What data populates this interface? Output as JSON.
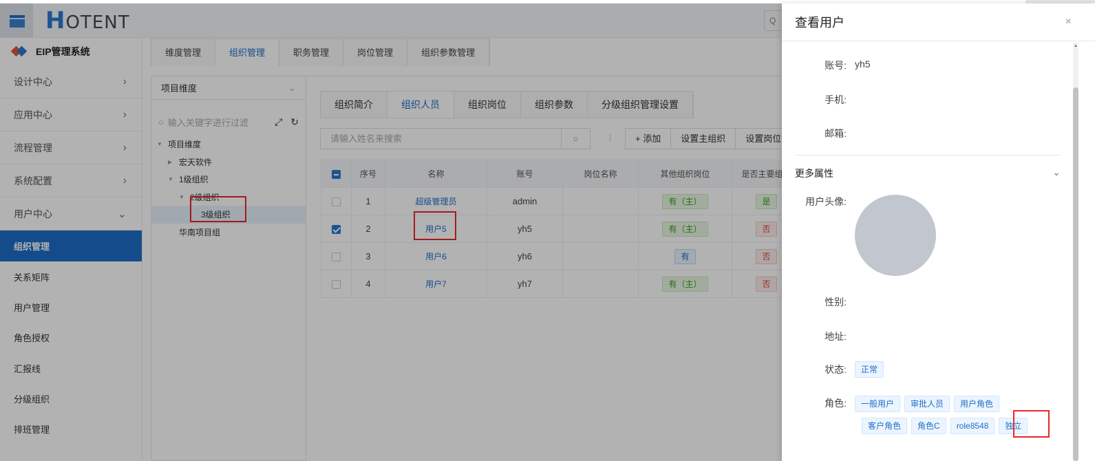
{
  "header": {
    "logo_text_big": "H",
    "logo_text_rest": "OTENT"
  },
  "sidebar": {
    "app_name": "EIP管理系统",
    "groups": [
      {
        "label": "设计中心",
        "chevron": ">"
      },
      {
        "label": "应用中心",
        "chevron": ">"
      },
      {
        "label": "流程管理",
        "chevron": ">"
      },
      {
        "label": "系统配置",
        "chevron": ">"
      },
      {
        "label": "用户中心",
        "chevron": "v"
      }
    ],
    "items": [
      {
        "label": "组织管理"
      },
      {
        "label": "关系矩阵"
      },
      {
        "label": "用户管理"
      },
      {
        "label": "角色授权"
      },
      {
        "label": "汇报线"
      },
      {
        "label": "分级组织"
      },
      {
        "label": "排班管理"
      }
    ]
  },
  "main_tabs": [
    "维度管理",
    "组织管理",
    "职务管理",
    "岗位管理",
    "组织参数管理"
  ],
  "tree": {
    "dimension": "项目维度",
    "search_placeholder": "输入关键字进行过滤",
    "nodes": [
      {
        "label": "项目维度"
      },
      {
        "label": "宏天软件"
      },
      {
        "label": "1级组织"
      },
      {
        "label": "2级组织"
      },
      {
        "label": "3级组织"
      },
      {
        "label": "华南项目组"
      }
    ]
  },
  "sub_tabs": [
    "组织简介",
    "组织人员",
    "组织岗位",
    "组织参数",
    "分级组织管理设置"
  ],
  "search": {
    "placeholder": "请输入姓名来搜索"
  },
  "actions": {
    "add": "+ 添加",
    "set_main_org": "设置主组织",
    "set_post": "设置岗位"
  },
  "table": {
    "headers": [
      "序号",
      "名称",
      "账号",
      "岗位名称",
      "其他组织岗位",
      "是否主要组织"
    ],
    "rows": [
      {
        "no": "1",
        "name": "超级管理员",
        "account": "admin",
        "post": "",
        "other": "有（主）",
        "main": "是"
      },
      {
        "no": "2",
        "name": "用户5",
        "account": "yh5",
        "post": "",
        "other": "有（主）",
        "main": "否"
      },
      {
        "no": "3",
        "name": "用户6",
        "account": "yh6",
        "post": "",
        "other": "有",
        "main": "否"
      },
      {
        "no": "4",
        "name": "用户7",
        "account": "yh7",
        "post": "",
        "other": "有（主）",
        "main": "否"
      }
    ]
  },
  "drawer": {
    "title": "查看用户",
    "close": "×",
    "account_label": "账号:",
    "account_value": "yh5",
    "phone_label": "手机:",
    "email_label": "邮箱:",
    "more_props": "更多属性",
    "avatar_label": "用户头像:",
    "gender_label": "性别:",
    "address_label": "地址:",
    "status_label": "状态:",
    "status_value": "正常",
    "roles_label": "角色:",
    "roles": [
      "一般用户",
      "审批人员",
      "用户角色",
      "客户角色",
      "角色C",
      "role8548",
      "独立"
    ]
  }
}
